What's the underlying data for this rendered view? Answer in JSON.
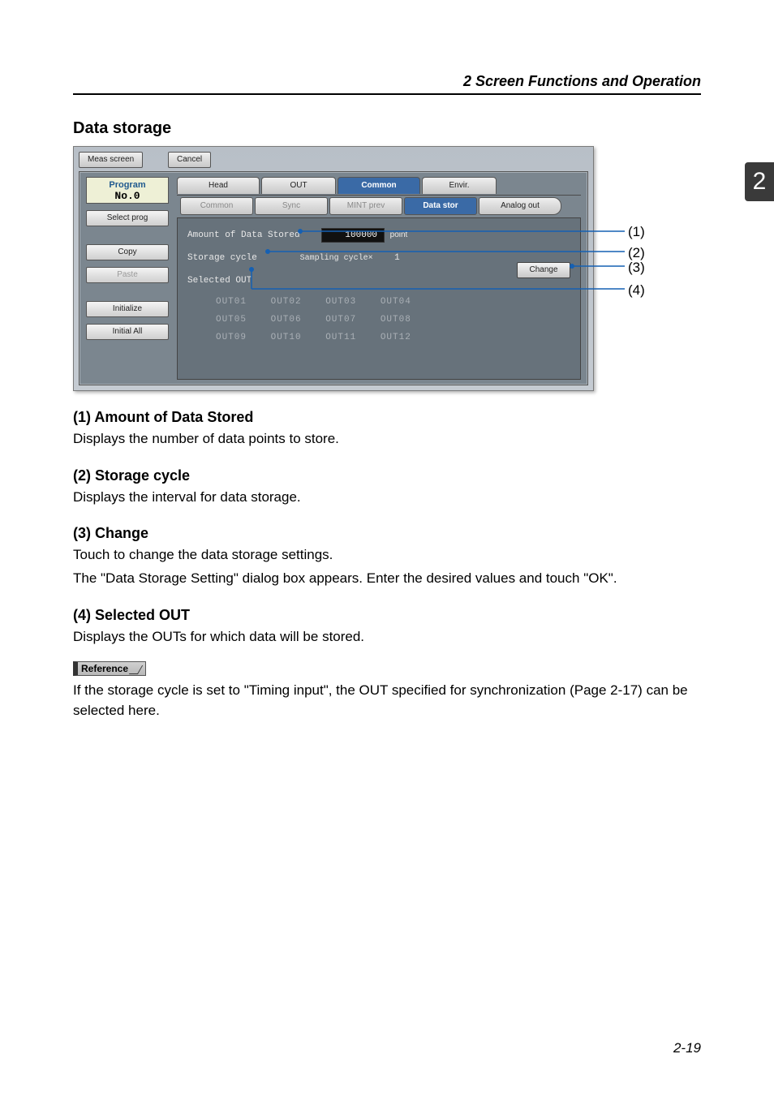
{
  "header": {
    "title": "2  Screen Functions and Operation"
  },
  "side_tab": "2",
  "section_title": "Data storage",
  "footer_page": "2-19",
  "shot": {
    "top_tabs": {
      "meas": "Meas screen",
      "cancel": "Cancel"
    },
    "left": {
      "program_label": "Program",
      "program_no": "No.0",
      "select_prog": "Select prog",
      "copy": "Copy",
      "paste": "Paste",
      "initialize": "Initialize",
      "initial_all": "Initial All"
    },
    "tabs_top": [
      "Head",
      "OUT",
      "Common",
      "Envir."
    ],
    "tabs_top_active_index": 2,
    "tabs_sub": [
      "Common",
      "Sync",
      "MINT prev",
      "Data stor",
      "Analog out"
    ],
    "tabs_sub_active_index": 3,
    "content": {
      "amount_label": "Amount of Data Stored",
      "amount_value": "100000",
      "amount_unit": "point",
      "storage_label": "Storage cycle",
      "sampling_label": "Sampling cycle×",
      "sampling_value": "1",
      "selected_label": "Selected OUT",
      "change_label": "Change",
      "outs": [
        [
          "OUT01",
          "OUT02",
          "OUT03",
          "OUT04"
        ],
        [
          "OUT05",
          "OUT06",
          "OUT07",
          "OUT08"
        ],
        [
          "OUT09",
          "OUT10",
          "OUT11",
          "OUT12"
        ]
      ]
    }
  },
  "callouts": {
    "c1": "(1)",
    "c2": "(2)",
    "c3": "(3)",
    "c4": "(4)"
  },
  "body": {
    "h1": "(1) Amount of Data Stored",
    "p1": "Displays the number of data points to store.",
    "h2": "(2) Storage cycle",
    "p2": "Displays the interval for data storage.",
    "h3": "(3) Change",
    "p3a": "Touch to change the data storage settings.",
    "p3b": "The \"Data Storage Setting\" dialog box appears. Enter the desired values and touch \"OK\".",
    "h4": "(4) Selected OUT",
    "p4": "Displays the OUTs for which data will be stored.",
    "ref_label": "Reference",
    "ref_text": "If the storage cycle is set to \"Timing input\", the OUT specified for synchronization (Page 2-17) can be selected here."
  }
}
